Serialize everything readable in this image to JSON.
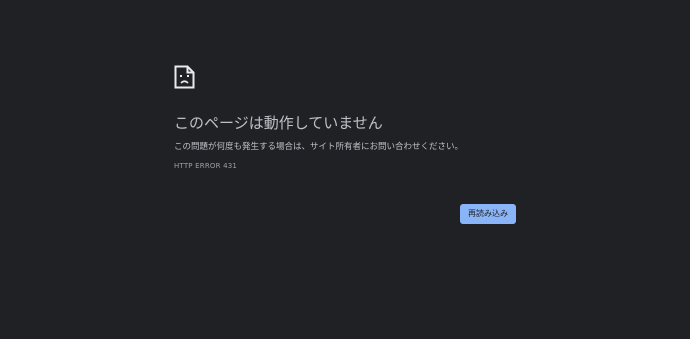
{
  "error_page": {
    "icon": "sad-page-icon",
    "title": "このページは動作していません",
    "description": "この問題が何度も発生する場合は、サイト所有者にお問い合わせください。",
    "error_code": "HTTP ERROR 431",
    "reload_label": "再読み込み"
  },
  "colors": {
    "background": "#202124",
    "text": "#bdc1c6",
    "secondary_text": "#9aa0a6",
    "button": "#8ab4f8"
  }
}
